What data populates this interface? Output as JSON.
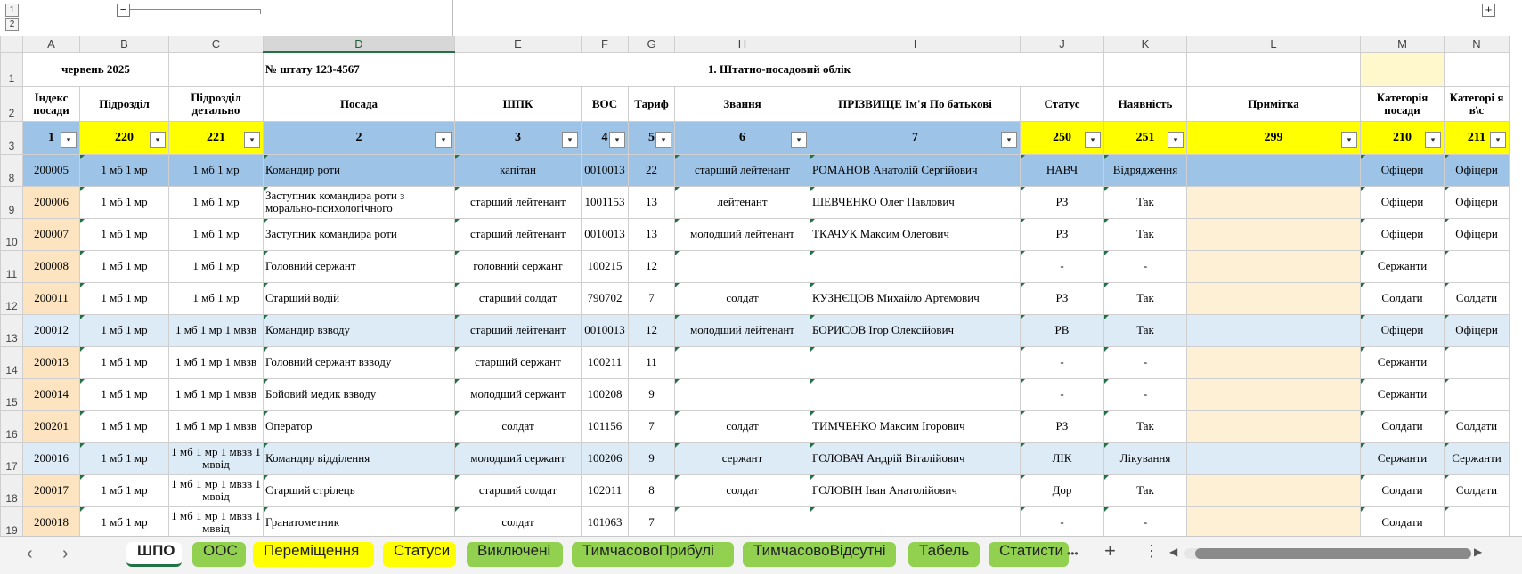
{
  "outline": {
    "level1": "1",
    "level2": "2",
    "collapse": "−",
    "expand": "+"
  },
  "columns": [
    "A",
    "B",
    "C",
    "D",
    "E",
    "F",
    "G",
    "H",
    "I",
    "J",
    "K",
    "L",
    "M",
    "N"
  ],
  "row1": {
    "num": "1",
    "a": "червень 2025",
    "d": "№ штату 123-4567",
    "title": "1. Штатно-посадовий облік"
  },
  "headers": {
    "num": "2",
    "a": "Індекс посади",
    "b": "Підрозділ",
    "c": "Підрозділ детально",
    "d": "Посада",
    "e": "ШПК",
    "f": "ВОС",
    "g": "Тариф",
    "h": "Звання",
    "i": "ПРІЗВИЩЕ Ім'я По батькові",
    "j": "Статус",
    "k": "Наявність",
    "l": "Примітка",
    "m": "Категорія посади",
    "n": "Категорі я в\\с"
  },
  "filters": {
    "num": "3",
    "a": "1",
    "b": "220",
    "c": "221",
    "d": "2",
    "e": "3",
    "f": "4",
    "g": "5",
    "h": "6",
    "i": "7",
    "j": "250",
    "k": "251",
    "l": "299",
    "m": "210",
    "n": "211",
    "button": "▾"
  },
  "rows": [
    {
      "num": "8",
      "a": "200005",
      "b": "1 мб 1 мр",
      "c": "1 мб 1 мр",
      "d": "Командир роти",
      "e": "капітан",
      "f": "0010013",
      "g": "22",
      "h": "старший лейтенант",
      "i": "РОМАНОВ Анатолій Сергійович",
      "j": "НАВЧ",
      "k": "Відрядження",
      "l": "",
      "m": "Офіцери",
      "n": "Офіцери"
    },
    {
      "num": "9",
      "a": "200006",
      "b": "1 мб 1 мр",
      "c": "1 мб 1 мр",
      "d": "Заступник командира роти з морально-психологічного",
      "e": "старший лейтенант",
      "f": "1001153",
      "g": "13",
      "h": "лейтенант",
      "i": "ШЕВЧЕНКО Олег Павлович",
      "j": "РЗ",
      "k": "Так",
      "l": "",
      "m": "Офіцери",
      "n": "Офіцери"
    },
    {
      "num": "10",
      "a": "200007",
      "b": "1 мб 1 мр",
      "c": "1 мб 1 мр",
      "d": "Заступник командира роти",
      "e": "старший лейтенант",
      "f": "0010013",
      "g": "13",
      "h": "молодший лейтенант",
      "i": "ТКАЧУК Максим Олегович",
      "j": "РЗ",
      "k": "Так",
      "l": "",
      "m": "Офіцери",
      "n": "Офіцери"
    },
    {
      "num": "11",
      "a": "200008",
      "b": "1 мб 1 мр",
      "c": "1 мб 1 мр",
      "d": "Головний сержант",
      "e": "головний сержант",
      "f": "100215",
      "g": "12",
      "h": "",
      "i": "",
      "j": "-",
      "k": "-",
      "l": "",
      "m": "Сержанти",
      "n": ""
    },
    {
      "num": "12",
      "a": "200011",
      "b": "1 мб 1 мр",
      "c": "1 мб 1 мр",
      "d": "Старший водій",
      "e": "старший солдат",
      "f": "790702",
      "g": "7",
      "h": "солдат",
      "i": "КУЗНЄЦОВ Михайло Артемович",
      "j": "РЗ",
      "k": "Так",
      "l": "",
      "m": "Солдати",
      "n": "Солдати"
    },
    {
      "num": "13",
      "a": "200012",
      "b": "1 мб 1 мр",
      "c": "1 мб 1 мр 1 мвзв",
      "d": "Командир взводу",
      "e": "старший лейтенант",
      "f": "0010013",
      "g": "12",
      "h": "молодший лейтенант",
      "i": "БОРИСОВ Ігор Олексійович",
      "j": "РВ",
      "k": "Так",
      "l": "",
      "m": "Офіцери",
      "n": "Офіцери"
    },
    {
      "num": "14",
      "a": "200013",
      "b": "1 мб 1 мр",
      "c": "1 мб 1 мр 1 мвзв",
      "d": "Головний сержант взводу",
      "e": "старший сержант",
      "f": "100211",
      "g": "11",
      "h": "",
      "i": "",
      "j": "-",
      "k": "-",
      "l": "",
      "m": "Сержанти",
      "n": ""
    },
    {
      "num": "15",
      "a": "200014",
      "b": "1 мб 1 мр",
      "c": "1 мб 1 мр 1 мвзв",
      "d": "Бойовий медик взводу",
      "e": "молодший сержант",
      "f": "100208",
      "g": "9",
      "h": "",
      "i": "",
      "j": "-",
      "k": "-",
      "l": "",
      "m": "Сержанти",
      "n": ""
    },
    {
      "num": "16",
      "a": "200201",
      "b": "1 мб 1 мр",
      "c": "1 мб 1 мр 1 мвзв",
      "d": "Оператор",
      "e": "солдат",
      "f": "101156",
      "g": "7",
      "h": "солдат",
      "i": "ТИМЧЕНКО Максим Ігорович",
      "j": "РЗ",
      "k": "Так",
      "l": "",
      "m": "Солдати",
      "n": "Солдати"
    },
    {
      "num": "17",
      "a": "200016",
      "b": "1 мб 1 мр",
      "c": "1 мб 1 мр 1 мвзв 1 мввід",
      "d": "Командир відділення",
      "e": "молодший сержант",
      "f": "100206",
      "g": "9",
      "h": "сержант",
      "i": "ГОЛОВАЧ Андрій Віталійович",
      "j": "ЛІК",
      "k": "Лікування",
      "l": "",
      "m": "Сержанти",
      "n": "Сержанти"
    },
    {
      "num": "18",
      "a": "200017",
      "b": "1 мб 1 мр",
      "c": "1 мб 1 мр 1 мвзв 1 мввід",
      "d": "Старший стрілець",
      "e": "старший солдат",
      "f": "102011",
      "g": "8",
      "h": "солдат",
      "i": "ГОЛОВІН Іван Анатолійович",
      "j": "Дор",
      "k": "Так",
      "l": "",
      "m": "Солдати",
      "n": "Солдати"
    },
    {
      "num": "19",
      "a": "200018",
      "b": "1 мб 1 мр",
      "c": "1 мб 1 мр 1 мвзв 1 мввід",
      "d": "Гранатометник",
      "e": "солдат",
      "f": "101063",
      "g": "7",
      "h": "",
      "i": "",
      "j": "-",
      "k": "-",
      "l": "",
      "m": "Солдати",
      "n": ""
    }
  ],
  "tabs": {
    "t0": "ШПО",
    "t1": "ООС",
    "t2": "Переміщення",
    "t3": "Статуси",
    "t4": "Виключені",
    "t5": "ТимчасовоПрибулі",
    "t6": "ТимчасовоВідсутні",
    "t7": "Табель",
    "t8": "Статисти"
  },
  "tabbar": {
    "prev": "‹",
    "next": "›",
    "more": "•••",
    "add": "+",
    "menu": "⋮",
    "left": "◀",
    "right": "▶"
  },
  "colors": {
    "accent": "#217346",
    "yellow": "#ffff00",
    "blue": "#9dc3e6",
    "green_tab": "#92d050",
    "red_text": "#ff0000",
    "green_text": "#00b050"
  }
}
